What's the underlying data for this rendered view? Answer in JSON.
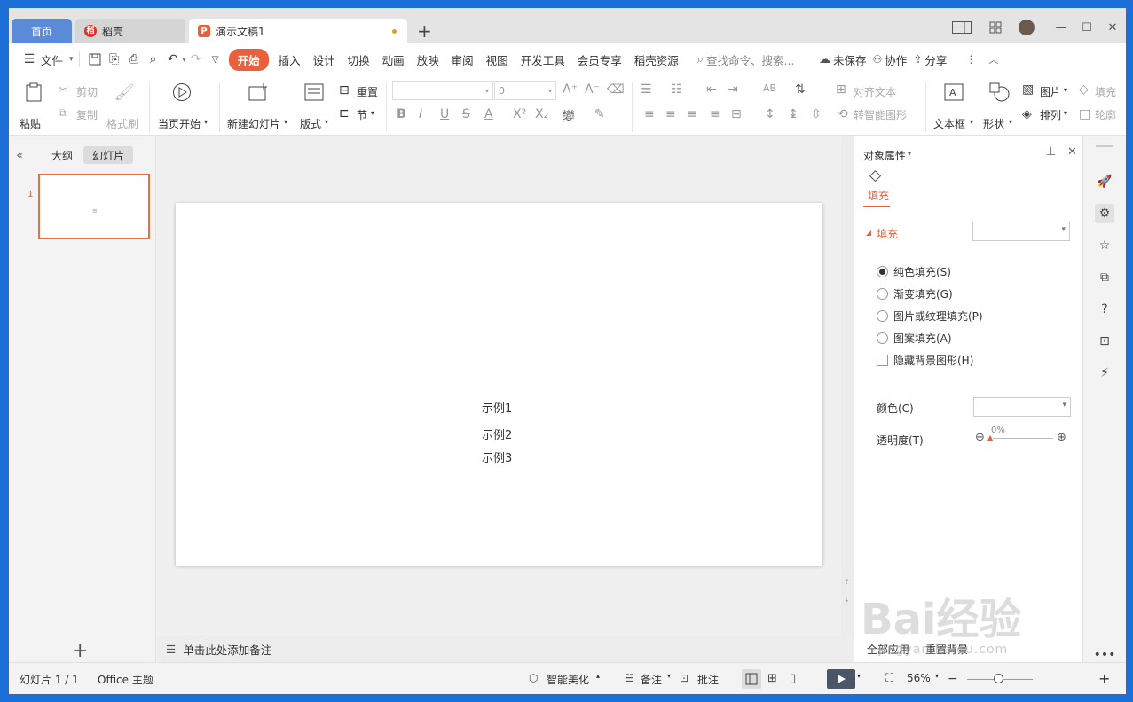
{
  "tabs": {
    "home": "首页",
    "daoke": "稻壳",
    "doc": "演示文稿1",
    "add": "+"
  },
  "menu": {
    "file": "文件",
    "items": [
      "开始",
      "插入",
      "设计",
      "切换",
      "动画",
      "放映",
      "审阅",
      "视图",
      "开发工具",
      "会员专享",
      "稻壳资源"
    ],
    "search": "查找命令、搜索...",
    "unsaved": "未保存",
    "collab": "协作",
    "share": "分享"
  },
  "ribbon": {
    "paste": "粘贴",
    "cut": "剪切",
    "copy": "复制",
    "format_painter": "格式刷",
    "from_current": "当页开始",
    "new_slide": "新建幻灯片",
    "layout": "版式",
    "reset": "重置",
    "section": "节",
    "font_size": "0",
    "align_text": "对齐文本",
    "smart_shape": "转智能图形",
    "textbox": "文本框",
    "shape": "形状",
    "picture": "图片",
    "arrange": "排列",
    "fill": "填充",
    "outline": "轮廓"
  },
  "left_panel": {
    "outline_tab": "大纲",
    "slides_tab": "幻灯片",
    "slide_number": "1",
    "add": "+"
  },
  "slide": {
    "lines": [
      "示例1",
      "示例2",
      "示例3"
    ]
  },
  "notes": "单击此处添加备注",
  "right_panel": {
    "title": "对象属性",
    "fill_tab": "填充",
    "fill_section": "填充",
    "options": [
      "纯色填充(S)",
      "渐变填充(G)",
      "图片或纹理填充(P)",
      "图案填充(A)"
    ],
    "hide_bg": "隐藏背景图形(H)",
    "color_label": "颜色(C)",
    "transparency_label": "透明度(T)",
    "transparency_value": "0%",
    "apply_all": "全部应用",
    "reset_bg": "重置背景"
  },
  "status": {
    "slide_info": "幻灯片 1 / 1",
    "theme": "Office 主题",
    "beautify": "智能美化",
    "notes": "备注",
    "comments": "批注",
    "zoom": "56%"
  },
  "watermark": {
    "brand": "Bai经验",
    "url": "jingyan.baidu.com"
  },
  "colors": {
    "accent": "#e8603c",
    "home_tab": "#5b8ad9",
    "desktop": "#1c6fd6"
  }
}
